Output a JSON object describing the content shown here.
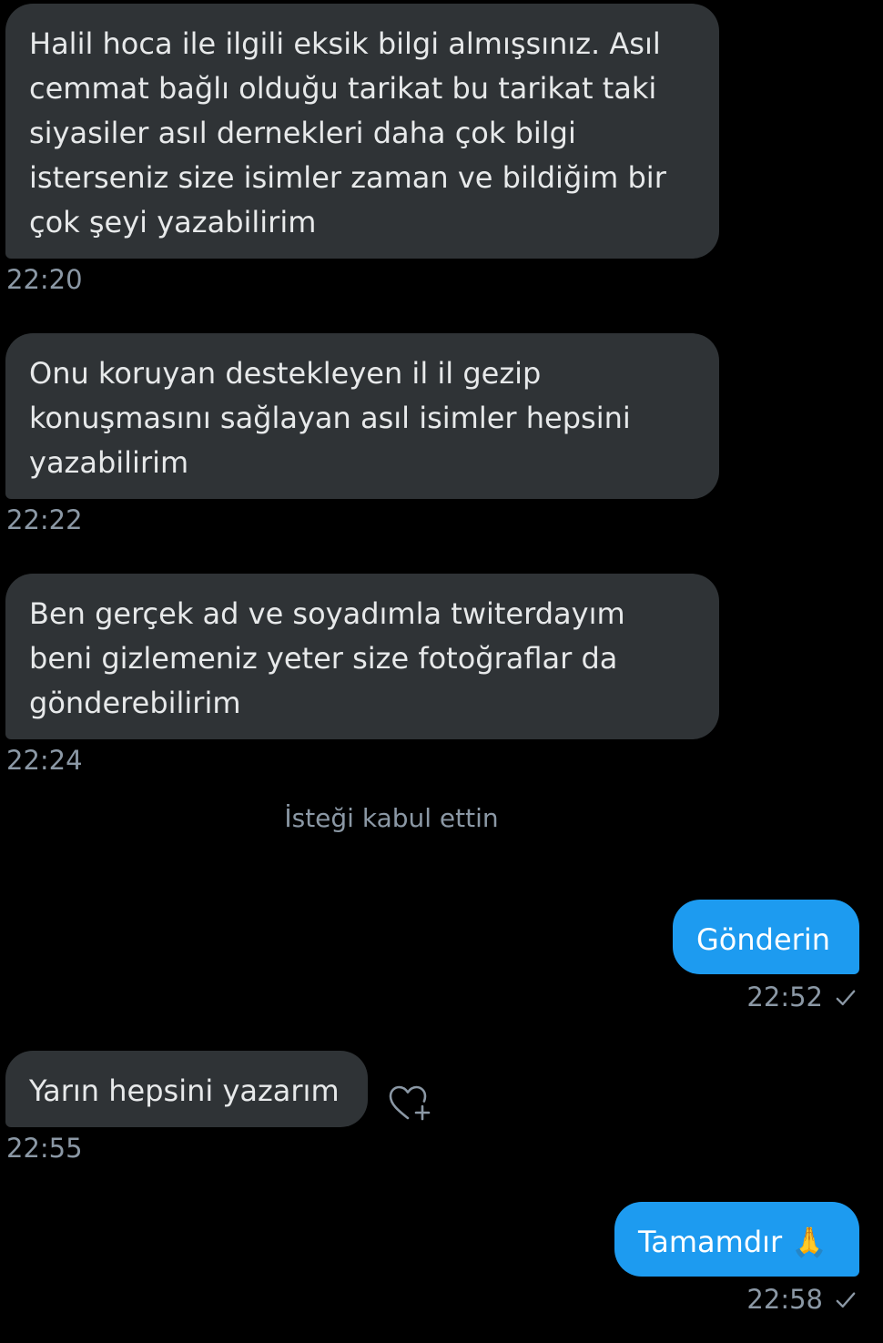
{
  "messages": [
    {
      "text": "Halil hoca ile ilgili eksik bilgi almışsınız. Asıl cemmat bağlı olduğu tarikat bu tarikat taki siyasiler asıl dernekleri daha çok bilgi isterseniz size isimler zaman ve bildiğim bir çok şeyi yazabilirim",
      "time": "22:20"
    },
    {
      "text": "Onu koruyan destekleyen il il gezip konuşmasını sağlayan asıl isimler hepsini yazabilirim",
      "time": "22:22"
    },
    {
      "text": "Ben gerçek ad ve soyadımla twiterdayım beni gizlemeniz yeter size fotoğraflar da gönderebilirim",
      "time": "22:24"
    },
    {
      "system": "İsteği kabul ettin"
    },
    {
      "text": "Gönderin",
      "time": "22:52"
    },
    {
      "text": "Yarın hepsini yazarım",
      "time": "22:55"
    },
    {
      "text": "Tamamdır 🙏",
      "time": "22:58"
    }
  ],
  "colors": {
    "incoming_bubble": "#2f3336",
    "outgoing_bubble": "#1d9bf0",
    "timestamp": "#8b98a5",
    "background": "#000000"
  },
  "icons": {
    "sent": "check-icon",
    "reaction": "heart-plus-icon"
  }
}
